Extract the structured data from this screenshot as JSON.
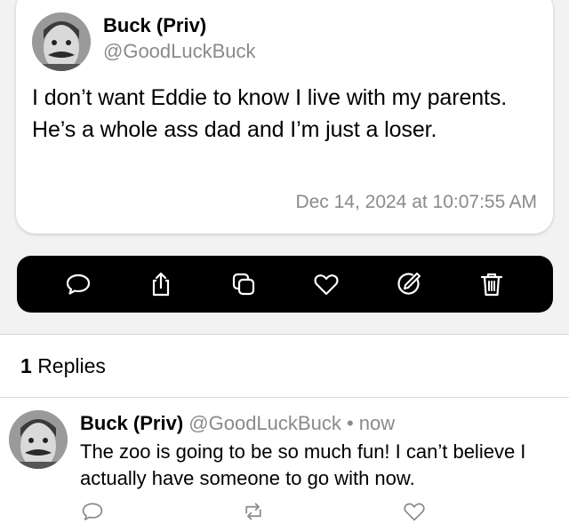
{
  "post": {
    "author_name": "Buck (Priv)",
    "author_handle": "@GoodLuckBuck",
    "text": "I don’t want Eddie to know I live with my parents. He’s a whole ass dad and I’m just a loser.",
    "timestamp": "Dec 14, 2024 at 10:07:55 AM"
  },
  "action_bar": {
    "icons": [
      "reply-icon",
      "share-icon",
      "copy-icon",
      "like-icon",
      "edit-icon",
      "delete-icon"
    ]
  },
  "replies": {
    "count": "1",
    "label": "Replies",
    "items": [
      {
        "author_name": "Buck (Priv)",
        "author_handle": "@GoodLuckBuck",
        "separator": "•",
        "time": "now",
        "text": "The zoo is going to be so much fun! I can’t believe I actually have someone to go with now."
      }
    ]
  },
  "colors": {
    "background": "#f2f2f2",
    "card": "#ffffff",
    "action_bar": "#000000",
    "secondary_text": "#8a8a8e"
  }
}
